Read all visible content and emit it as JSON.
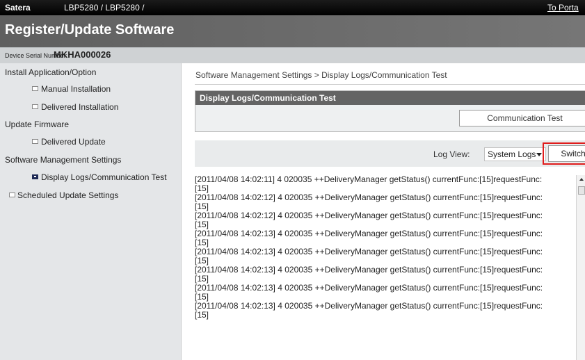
{
  "topbar": {
    "brand": "Satera",
    "model": "LBP5280 / LBP5280 /",
    "portal_link": "To Porta"
  },
  "header": {
    "title": "Register/Update Software",
    "serial_label": "Device Serial Number:",
    "serial_value": "MKHA000026"
  },
  "sidebar": {
    "items": [
      {
        "label": "Install Application/Option"
      },
      {
        "label": "Manual Installation"
      },
      {
        "label": "Delivered Installation"
      },
      {
        "label": "Update Firmware"
      },
      {
        "label": "Delivered Update"
      },
      {
        "label": "Software Management Settings"
      },
      {
        "label": "Display Logs/Communication Test"
      },
      {
        "label": "Scheduled Update Settings"
      }
    ]
  },
  "main": {
    "breadcrumb": "Software Management Settings > Display Logs/Communication Test",
    "panel_title": "Display Logs/Communication Test",
    "communication_test_button": "Communication Test",
    "log_view_label": "Log View:",
    "log_view_selected": "System Logs",
    "switch_button": "Switch",
    "log_lines": [
      "[2011/04/08 14:02:11] 4 020035 ++DeliveryManager getStatus() currentFunc:[15]requestFunc:",
      "[15]",
      "[2011/04/08 14:02:12] 4 020035 ++DeliveryManager getStatus() currentFunc:[15]requestFunc:",
      "[15]",
      "[2011/04/08 14:02:12] 4 020035 ++DeliveryManager getStatus() currentFunc:[15]requestFunc:",
      "[15]",
      "[2011/04/08 14:02:13] 4 020035 ++DeliveryManager getStatus() currentFunc:[15]requestFunc:",
      "[15]",
      "[2011/04/08 14:02:13] 4 020035 ++DeliveryManager getStatus() currentFunc:[15]requestFunc:",
      "[15]",
      "[2011/04/08 14:02:13] 4 020035 ++DeliveryManager getStatus() currentFunc:[15]requestFunc:",
      "[15]",
      "[2011/04/08 14:02:13] 4 020035 ++DeliveryManager getStatus() currentFunc:[15]requestFunc:",
      "[15]",
      "[2011/04/08 14:02:13] 4 020035 ++DeliveryManager getStatus() currentFunc:[15]requestFunc:",
      "[15]"
    ]
  },
  "colors": {
    "highlight_outline": "#e01c1c",
    "topbar": "#000000",
    "titlebar": "#6a6a6a",
    "sidebar_bg": "#e4e6e8"
  }
}
